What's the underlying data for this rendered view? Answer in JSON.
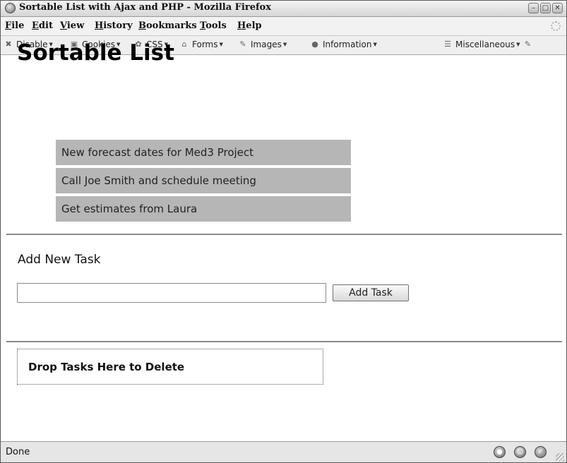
{
  "window": {
    "title": "Sortable List with Ajax and PHP - Mozilla Firefox",
    "controls": [
      "minimize-icon",
      "maximize-icon",
      "close-icon"
    ]
  },
  "menu": {
    "items": [
      "File",
      "Edit",
      "View",
      "History",
      "Bookmarks",
      "Tools",
      "Help"
    ]
  },
  "toolbar": {
    "items": [
      {
        "label": "Disable",
        "icon": "disable-icon"
      },
      {
        "label": "Cookies",
        "icon": "cookies-icon"
      },
      {
        "label": "CSS",
        "icon": "css-icon"
      },
      {
        "label": "Forms",
        "icon": "forms-icon"
      },
      {
        "label": "Images",
        "icon": "images-icon"
      },
      {
        "label": "Information",
        "icon": "information-icon"
      },
      {
        "label": "Miscellaneous",
        "icon": "miscellaneous-icon"
      }
    ]
  },
  "page": {
    "heading": "Sortable List",
    "tasks": [
      "New forecast dates for Med3 Project",
      "Call Joe Smith and schedule meeting",
      "Get estimates from Laura"
    ],
    "add_heading": "Add New Task",
    "task_input_value": "",
    "add_button": "Add Task",
    "drop_zone": "Drop Tasks Here to Delete"
  },
  "status": {
    "text": "Done"
  },
  "colors": {
    "task_background": "#b6b6b6",
    "chrome": "#efefef"
  }
}
